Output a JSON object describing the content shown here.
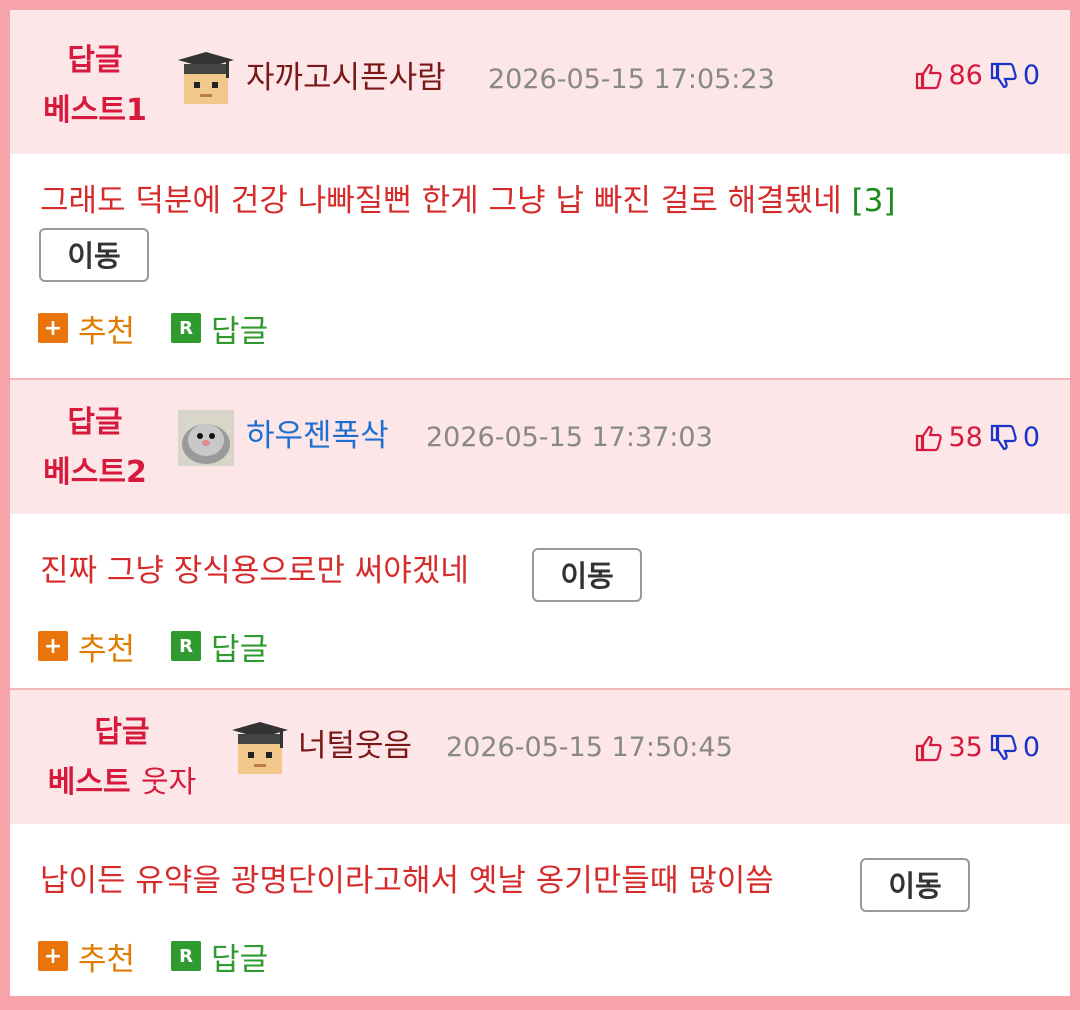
{
  "comments": [
    {
      "badge_line1": "답글",
      "badge_line2": "베스트1",
      "badge_suffix": "",
      "nickname": "자까고시픈사람",
      "nickname_color": "#7a1818",
      "avatar": "graduate-avatar-icon",
      "datetime": "2026-05-15 17:05:23",
      "likes": "86",
      "dislikes": "0",
      "text": "그래도 덕분에 건강 나빠질뻔 한게 그냥 납 빠진 걸로 해결됐네",
      "reply_count": "[3]",
      "move_label": "이동",
      "recommend_label": "추천",
      "reply_label": "답글"
    },
    {
      "badge_line1": "답글",
      "badge_line2": "베스트2",
      "badge_suffix": "",
      "nickname": "하우젠폭삭",
      "nickname_color": "#1e6fd0",
      "avatar": "bird-avatar-icon",
      "datetime": "2026-05-15 17:37:03",
      "likes": "58",
      "dislikes": "0",
      "text": "진짜 그냥 장식용으로만 써야겠네",
      "reply_count": "",
      "move_label": "이동",
      "recommend_label": "추천",
      "reply_label": "답글"
    },
    {
      "badge_line1": "답글",
      "badge_line2": "베스트",
      "badge_suffix": "웃자",
      "nickname": "너털웃음",
      "nickname_color": "#7a1818",
      "avatar": "graduate-avatar-icon",
      "datetime": "2026-05-15 17:50:45",
      "likes": "35",
      "dislikes": "0",
      "text": "납이든 유약을 광명단이라고해서 옛날 옹기만들때 많이씀",
      "reply_count": "",
      "move_label": "이동",
      "recommend_label": "추천",
      "reply_label": "답글"
    }
  ],
  "icons": {
    "thumbs_up": "thumbs-up-icon",
    "thumbs_down": "thumbs-down-icon",
    "plus": "plus-icon",
    "reply": "reply-r-icon"
  },
  "colors": {
    "badge": "#d6193d",
    "comment_text": "#d62b2b",
    "header_bg": "#fde6e8",
    "border": "#f6a3aa"
  }
}
